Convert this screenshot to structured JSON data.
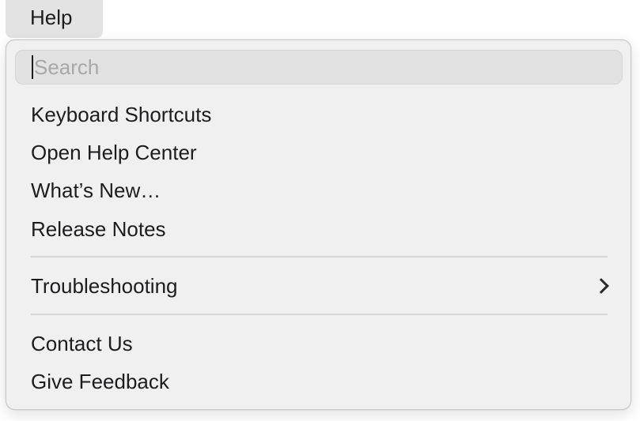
{
  "menubar": {
    "active_menu": "Help"
  },
  "help_menu": {
    "search": {
      "placeholder": "Search",
      "value": ""
    },
    "group_1": [
      {
        "label": "Keyboard Shortcuts"
      },
      {
        "label": "Open Help Center"
      },
      {
        "label": "What’s New…"
      },
      {
        "label": "Release Notes"
      }
    ],
    "group_2": [
      {
        "label": "Troubleshooting",
        "submenu_icon": "chevron-right-icon"
      }
    ],
    "group_3": [
      {
        "label": "Contact Us"
      },
      {
        "label": "Give Feedback"
      }
    ]
  }
}
